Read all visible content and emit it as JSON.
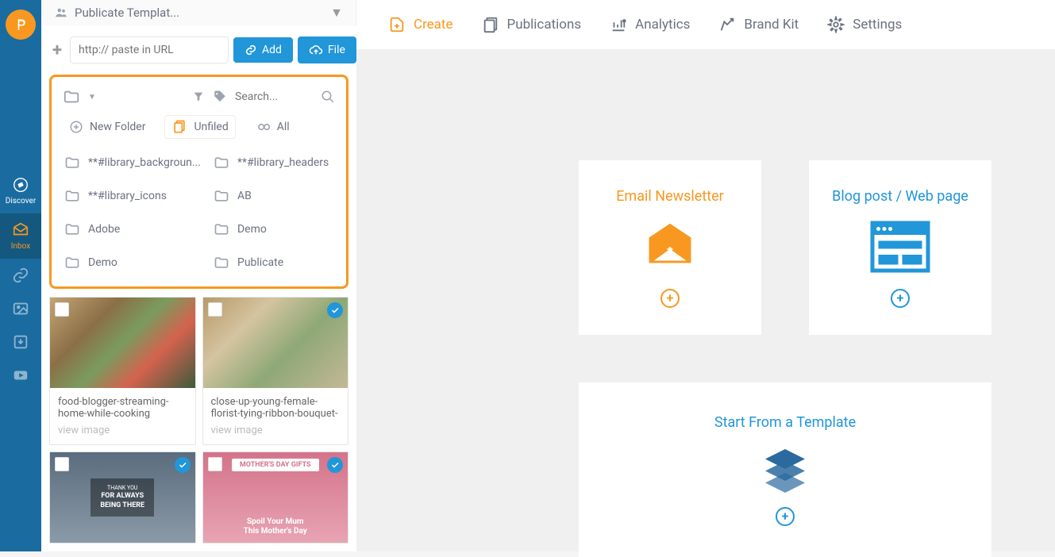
{
  "rail": {
    "discover": "Discover",
    "inbox": "Inbox"
  },
  "sidebar": {
    "header": "Publicate Templat...",
    "url_placeholder": "http:// paste in URL",
    "add_label": "Add",
    "file_label": "File",
    "search_placeholder": "Search...",
    "new_folder": "New Folder",
    "unfiled": "Unfiled",
    "all": "All",
    "folders": [
      "**#library_backgroun...",
      "**#library_headers",
      "**#library_icons",
      "AB",
      "Adobe",
      "Demo",
      "Demo",
      "Publicate"
    ]
  },
  "thumbs": [
    {
      "title": "food-blogger-streaming-home-while-cooking",
      "view": "view image",
      "badge": false
    },
    {
      "title": "close-up-young-female-florist-tying-ribbon-bouquet-",
      "view": "view image",
      "badge": true
    },
    {
      "overlay_line1": "THANK YOU",
      "overlay_line2": "FOR ALWAYS",
      "overlay_line3": "BEING THERE",
      "badge": true
    },
    {
      "overlay_top": "MOTHER'S DAY GIFTS",
      "overlay_bottom1": "Spoil Your Mum",
      "overlay_bottom2": "This Mother's Day",
      "badge": true
    }
  ],
  "nav": {
    "create": "Create",
    "publications": "Publications",
    "analytics": "Analytics",
    "brand_kit": "Brand Kit",
    "settings": "Settings"
  },
  "main": {
    "email": "Email Newsletter",
    "blog": "Blog post / Web page",
    "template": "Start From a Template"
  }
}
